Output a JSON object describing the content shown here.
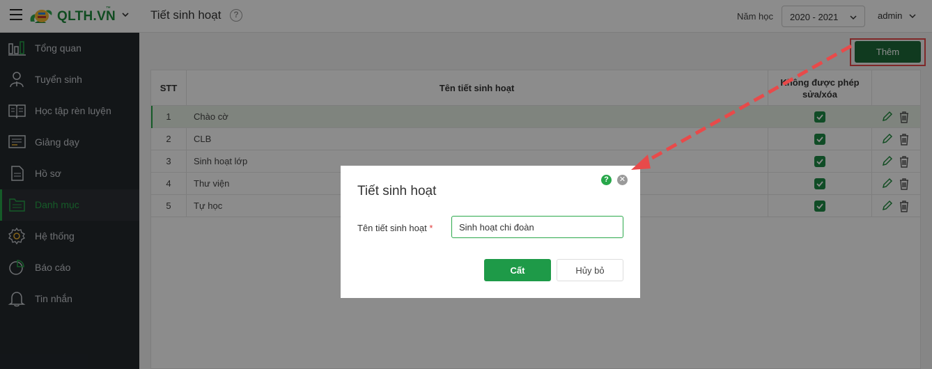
{
  "header": {
    "logo_text": "QLTH.VN",
    "logo_tm": "™",
    "page_title": "Tiết sinh hoạt",
    "year_label": "Năm học",
    "year_value": "2020 - 2021",
    "user_name": "admin"
  },
  "sidebar": {
    "items": [
      {
        "label": "Tổng quan",
        "icon": "bar-chart-icon"
      },
      {
        "label": "Tuyển sinh",
        "icon": "student-icon"
      },
      {
        "label": "Học tập rèn luyện",
        "icon": "book-icon"
      },
      {
        "label": "Giảng dạy",
        "icon": "board-icon"
      },
      {
        "label": "Hồ sơ",
        "icon": "document-icon"
      },
      {
        "label": "Danh mục",
        "icon": "folder-icon",
        "active": true
      },
      {
        "label": "Hệ thống",
        "icon": "gear-icon"
      },
      {
        "label": "Báo cáo",
        "icon": "pie-chart-icon"
      },
      {
        "label": "Tin nhắn",
        "icon": "bell-icon"
      }
    ]
  },
  "toolbar": {
    "add_label": "Thêm"
  },
  "table": {
    "headers": {
      "stt": "STT",
      "name": "Tên tiết sinh hoạt",
      "locked": "Không được phép sửa/xóa"
    },
    "rows": [
      {
        "stt": "1",
        "name": "Chào cờ",
        "locked": true
      },
      {
        "stt": "2",
        "name": "CLB",
        "locked": true
      },
      {
        "stt": "3",
        "name": "Sinh hoạt lớp",
        "locked": true
      },
      {
        "stt": "4",
        "name": "Thư viện",
        "locked": true
      },
      {
        "stt": "5",
        "name": "Tự học",
        "locked": true
      }
    ]
  },
  "modal": {
    "title": "Tiết sinh hoạt",
    "help_glyph": "?",
    "close_glyph": "✕",
    "field_label": "Tên tiết sinh hoạt",
    "required_mark": "*",
    "field_value": "Sinh hoạt chi đoàn",
    "save_label": "Cất",
    "cancel_label": "Hủy bỏ"
  },
  "colors": {
    "brand_green": "#1e8a3c",
    "sidebar_bg": "#23282d",
    "add_button": "#1e6b3a",
    "annotation_red": "#e84a4a"
  }
}
